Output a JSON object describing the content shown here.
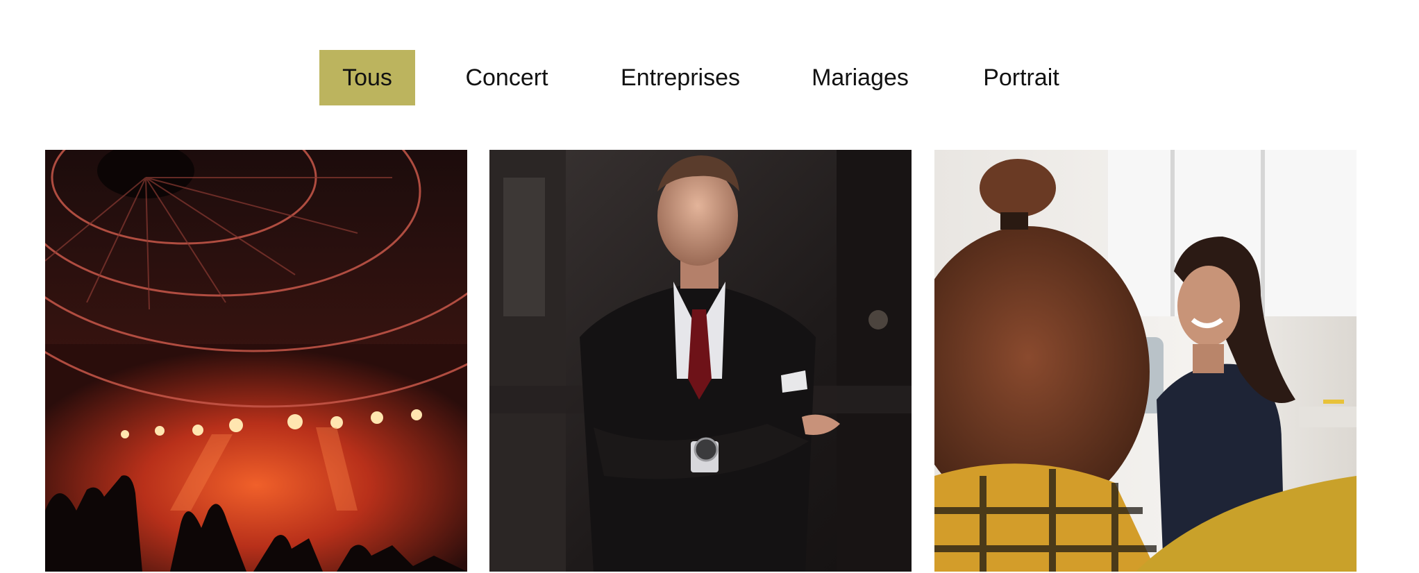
{
  "theme": {
    "accent": "#bcb45e"
  },
  "filters": [
    {
      "label": "Tous",
      "active": true
    },
    {
      "label": "Concert",
      "active": false
    },
    {
      "label": "Entreprises",
      "active": false
    },
    {
      "label": "Mariages",
      "active": false
    },
    {
      "label": "Portrait",
      "active": false
    }
  ],
  "gallery": [
    {
      "category": "Concert"
    },
    {
      "category": "Portrait"
    },
    {
      "category": "Entreprises"
    }
  ]
}
